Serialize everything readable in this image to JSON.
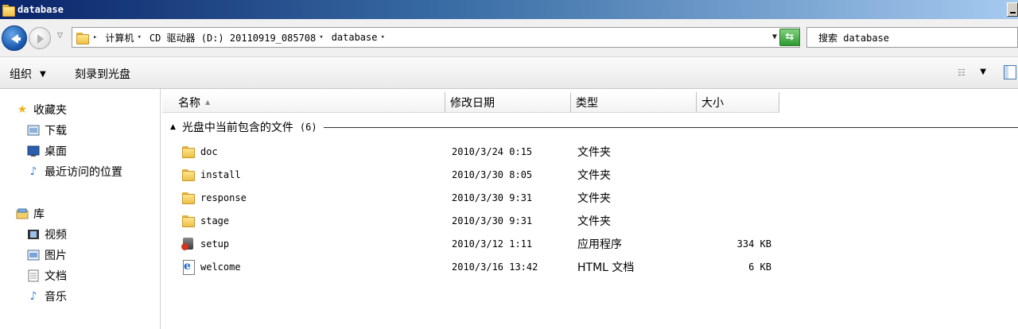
{
  "window": {
    "title": "database"
  },
  "address": {
    "crumbs": [
      "计算机",
      "CD 驱动器 (D:) 20110919_085708",
      "database"
    ]
  },
  "search": {
    "placeholder": "搜索 database"
  },
  "toolbar": {
    "organize": "组织",
    "burn": "刻录到光盘"
  },
  "nav": {
    "favorites": {
      "label": "收藏夹",
      "items": [
        "下载",
        "桌面",
        "最近访问的位置"
      ]
    },
    "libraries": {
      "label": "库",
      "items": [
        "视频",
        "图片",
        "文档",
        "音乐"
      ]
    }
  },
  "columns": {
    "name": "名称",
    "date": "修改日期",
    "type": "类型",
    "size": "大小"
  },
  "group": {
    "label": "光盘中当前包含的文件",
    "count": "(6)"
  },
  "files": [
    {
      "name": "doc",
      "date": "2010/3/24 0:15",
      "type": "文件夹",
      "size": "",
      "icon": "folder-icon"
    },
    {
      "name": "install",
      "date": "2010/3/30 8:05",
      "type": "文件夹",
      "size": "",
      "icon": "folder-icon"
    },
    {
      "name": "response",
      "date": "2010/3/30 9:31",
      "type": "文件夹",
      "size": "",
      "icon": "folder-icon"
    },
    {
      "name": "stage",
      "date": "2010/3/30 9:31",
      "type": "文件夹",
      "size": "",
      "icon": "folder-icon"
    },
    {
      "name": "setup",
      "date": "2010/3/12 1:11",
      "type": "应用程序",
      "size": "334 KB",
      "icon": "application-icon"
    },
    {
      "name": "welcome",
      "date": "2010/3/16 13:42",
      "type": "HTML 文档",
      "size": "6 KB",
      "icon": "html-document-icon"
    }
  ]
}
